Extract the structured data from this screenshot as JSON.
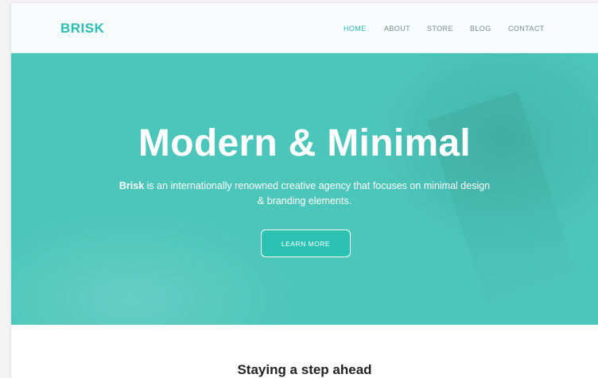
{
  "header": {
    "logo": "BRISK",
    "nav": [
      {
        "label": "HOME",
        "active": true
      },
      {
        "label": "ABOUT",
        "active": false
      },
      {
        "label": "STORE",
        "active": false
      },
      {
        "label": "BLOG",
        "active": false
      },
      {
        "label": "CONTACT",
        "active": false
      }
    ]
  },
  "hero": {
    "title": "Modern & Minimal",
    "description_brand": "Brisk",
    "description_rest": " is an internationally renowned creative agency that focuses on minimal design & branding elements.",
    "cta_label": "LEARN MORE"
  },
  "section": {
    "title": "Staying a step ahead"
  },
  "colors": {
    "accent": "#2bbfb2",
    "hero_background": "#4cc6bb",
    "nav_text": "#7d8a8a"
  }
}
